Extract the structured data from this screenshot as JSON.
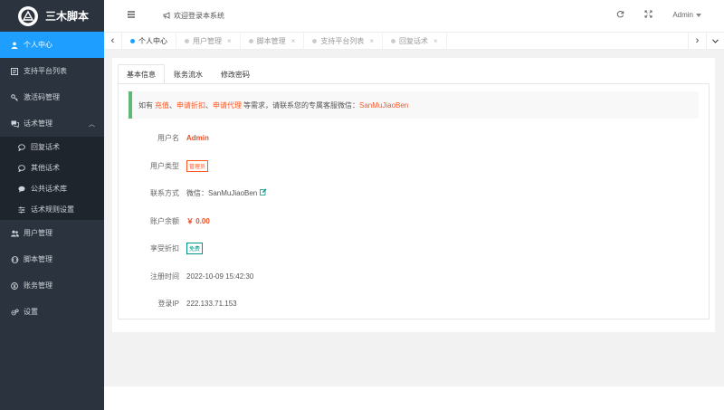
{
  "brand": {
    "name": "三木脚本"
  },
  "sidebar": {
    "items": [
      {
        "label": "个人中心",
        "icon": "user-icon",
        "active": true
      },
      {
        "label": "支持平台列表",
        "icon": "list-icon"
      },
      {
        "label": "激活码管理",
        "icon": "key-icon"
      },
      {
        "label": "话术管理",
        "icon": "chat-icon",
        "expanded": true
      },
      {
        "label": "用户管理",
        "icon": "users-icon"
      },
      {
        "label": "脚本管理",
        "icon": "code-icon"
      },
      {
        "label": "账务管理",
        "icon": "yen-icon"
      },
      {
        "label": "设置",
        "icon": "gear-icon"
      }
    ],
    "sub_items": [
      {
        "label": "回复话术",
        "icon": "reply-icon"
      },
      {
        "label": "其他话术",
        "icon": "comment-icon"
      },
      {
        "label": "公共话术库",
        "icon": "comment-filled-icon"
      },
      {
        "label": "话术规则设置",
        "icon": "sliders-icon"
      }
    ]
  },
  "header": {
    "welcome": "欢迎登录本系统",
    "user": "Admin"
  },
  "tabs": [
    {
      "label": "个人中心",
      "active": true
    },
    {
      "label": "用户管理"
    },
    {
      "label": "脚本管理"
    },
    {
      "label": "支持平台列表"
    },
    {
      "label": "回复话术"
    }
  ],
  "page_tabs": [
    "基本信息",
    "账务流水",
    "修改密码"
  ],
  "notice": {
    "prefix": "如有",
    "link1": "充值",
    "sep1": "、",
    "link2": "申请折扣",
    "sep2": "、",
    "link3": "申请代理",
    "middle": "等需求，请联系您的专属客服微信：",
    "wechat": "SanMuJiaoBen"
  },
  "profile": {
    "username_label": "用户名",
    "username": "Admin",
    "type_label": "用户类型",
    "type": "管理员",
    "contact_label": "联系方式",
    "contact": "微信：SanMuJiaoBen",
    "balance_label": "账户余额",
    "balance": "￥ 0.00",
    "discount_label": "享受折扣",
    "discount": "免费",
    "reg_time_label": "注册时间",
    "reg_time": "2022-10-09 15:42:30",
    "login_ip_label": "登录IP",
    "login_ip": "222.133.71.153"
  },
  "colors": {
    "sidebar_bg": "#2b333e",
    "active_blue": "#1e9fff",
    "accent_red": "#ff5722",
    "teal": "#009688",
    "notice_border": "#5fb878"
  }
}
